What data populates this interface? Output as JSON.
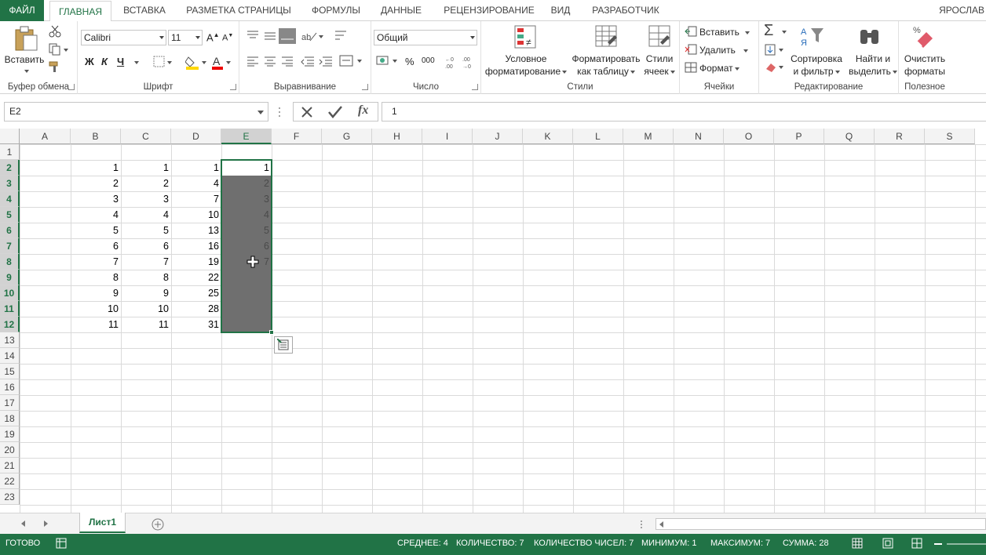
{
  "tabs": [
    "ФАЙЛ",
    "ГЛАВНАЯ",
    "ВСТАВКА",
    "РАЗМЕТКА СТРАНИЦЫ",
    "ФОРМУЛЫ",
    "ДАННЫЕ",
    "РЕЦЕНЗИРОВАНИЕ",
    "ВИД",
    "РАЗРАБОТЧИК"
  ],
  "active_tab": "ГЛАВНАЯ",
  "user_name": "ЯРОСЛАВ",
  "ribbon": {
    "clipboard": {
      "paste": "Вставить",
      "label": "Буфер обмена"
    },
    "font": {
      "name": "Calibri",
      "size": "11",
      "bold": "Ж",
      "italic": "К",
      "underline": "Ч",
      "label": "Шрифт"
    },
    "alignment": {
      "label": "Выравнивание"
    },
    "number": {
      "format": "Общий",
      "percent": "%",
      "thousands": "000",
      "label": "Число"
    },
    "styles": {
      "conditional_1": "Условное",
      "conditional_2": "форматирование",
      "table_1": "Форматировать",
      "table_2": "как таблицу",
      "cell_1": "Стили",
      "cell_2": "ячеек",
      "label": "Стили"
    },
    "cells": {
      "insert": "Вставить",
      "delete": "Удалить",
      "format": "Формат",
      "label": "Ячейки"
    },
    "editing": {
      "sort_1": "Сортировка",
      "sort_2": "и фильтр",
      "find_1": "Найти и",
      "find_2": "выделить",
      "label": "Редактирование"
    },
    "useful": {
      "clear_1": "Очистить",
      "clear_2": "форматы",
      "label": "Полезное"
    }
  },
  "formula_bar": {
    "name_box": "E2",
    "value": "1",
    "fx": "fx"
  },
  "columns": [
    "A",
    "B",
    "C",
    "D",
    "E",
    "F",
    "G",
    "H",
    "I",
    "J",
    "K",
    "L",
    "M",
    "N",
    "O",
    "P",
    "Q",
    "R",
    "S"
  ],
  "rows": [
    "1",
    "2",
    "3",
    "4",
    "5",
    "6",
    "7",
    "8",
    "9",
    "10",
    "11",
    "12",
    "13",
    "14",
    "15",
    "16",
    "17",
    "18",
    "19",
    "20",
    "21",
    "22",
    "23"
  ],
  "selected_column": "E",
  "selected_rows": [
    "2",
    "3",
    "4",
    "5",
    "6",
    "7",
    "8",
    "9",
    "10",
    "11",
    "12"
  ],
  "cells": {
    "B": [
      "",
      "1",
      "2",
      "3",
      "4",
      "5",
      "6",
      "7",
      "8",
      "9",
      "10",
      "11"
    ],
    "C": [
      "",
      "1",
      "2",
      "3",
      "4",
      "5",
      "6",
      "7",
      "8",
      "9",
      "10",
      "11"
    ],
    "D": [
      "",
      "1",
      "4",
      "7",
      "10",
      "13",
      "16",
      "19",
      "22",
      "25",
      "28",
      "31"
    ],
    "E": [
      "",
      "1",
      "2",
      "3",
      "4",
      "5",
      "6",
      "7",
      "",
      "",
      "",
      ""
    ]
  },
  "sheet_tab": "Лист1",
  "status": {
    "ready": "ГОТОВО",
    "average": "СРЕДНЕЕ: 4",
    "count": "КОЛИЧЕСТВО: 7",
    "numcount": "КОЛИЧЕСТВО ЧИСЕЛ: 7",
    "min": "МИНИМУМ: 1",
    "max": "МАКСИМУМ: 7",
    "sum": "СУММА: 28"
  },
  "colors": {
    "accent": "#217346",
    "selection": "#6f6f6f"
  }
}
